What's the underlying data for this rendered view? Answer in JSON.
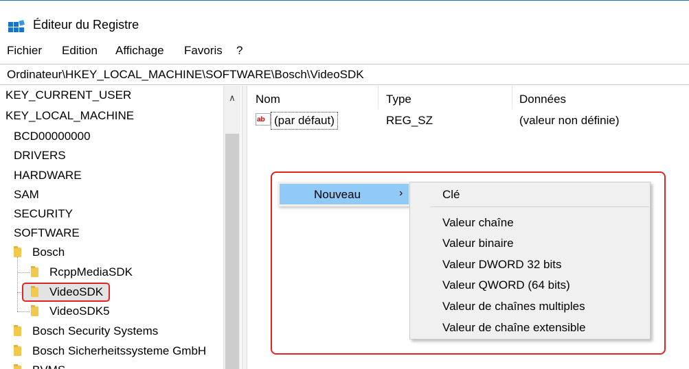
{
  "window": {
    "title": "Éditeur du Registre",
    "icon": "registry-icon"
  },
  "menubar": [
    "Fichier",
    "Edition",
    "Affichage",
    "Favoris",
    "?"
  ],
  "address": "Ordinateur\\HKEY_LOCAL_MACHINE\\SOFTWARE\\Bosch\\VideoSDK",
  "tree": {
    "nodes": [
      {
        "label": "KEY_CURRENT_USER"
      },
      {
        "label": "KEY_LOCAL_MACHINE"
      },
      {
        "label": "BCD00000000"
      },
      {
        "label": "DRIVERS"
      },
      {
        "label": "HARDWARE"
      },
      {
        "label": "SAM"
      },
      {
        "label": "SECURITY"
      },
      {
        "label": "SOFTWARE"
      },
      {
        "label": "Bosch"
      },
      {
        "label": "RcppMediaSDK"
      },
      {
        "label": "VideoSDK"
      },
      {
        "label": "VideoSDK5"
      },
      {
        "label": "Bosch Security Systems"
      },
      {
        "label": "Bosch Sicherheitssysteme GmbH"
      },
      {
        "label": "BVMS"
      }
    ],
    "selected": "VideoSDK"
  },
  "list": {
    "columns": [
      "Nom",
      "Type",
      "Données"
    ],
    "rows": [
      {
        "icon_text": "ab",
        "name": "(par défaut)",
        "type": "REG_SZ",
        "data": "(valeur non définie)"
      }
    ]
  },
  "context_menu": {
    "item": "Nouveau",
    "arrow": "›",
    "submenu": [
      "Clé",
      "Valeur chaîne",
      "Valeur binaire",
      "Valeur DWORD 32 bits",
      "Valeur QWORD (64 bits)",
      "Valeur de chaînes multiples",
      "Valeur de chaîne extensible"
    ]
  },
  "colors": {
    "highlight": "#e02424",
    "menu_selected": "#91c9f7",
    "folder": "#f2c94c",
    "title_border": "#1e6fb7"
  }
}
